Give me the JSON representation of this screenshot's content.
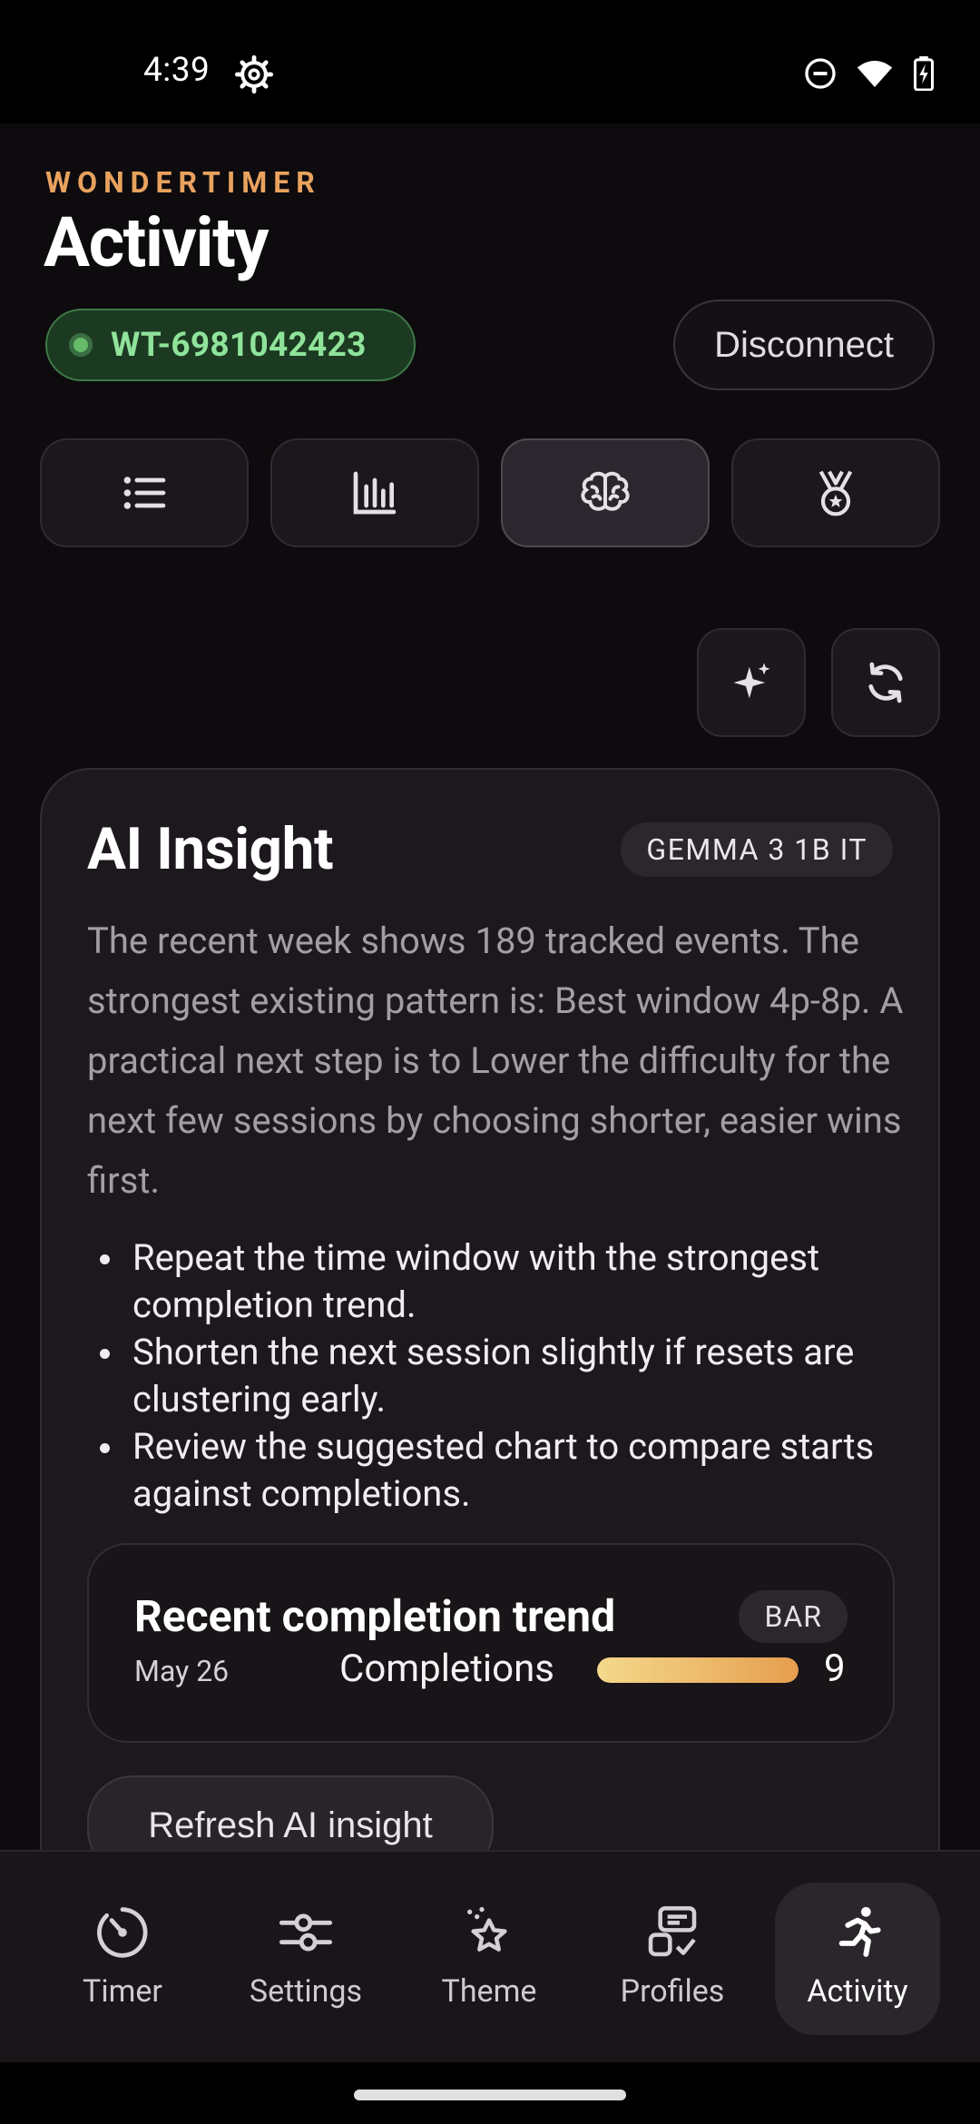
{
  "status_bar": {
    "time": "4:39"
  },
  "header": {
    "brand": "WONDERTIMER",
    "title": "Activity"
  },
  "device": {
    "id": "WT-6981042423",
    "disconnect_label": "Disconnect"
  },
  "tabs": [
    {
      "icon": "list-icon",
      "active": false
    },
    {
      "icon": "bar-chart-icon",
      "active": false
    },
    {
      "icon": "brain-icon",
      "active": true
    },
    {
      "icon": "medal-icon",
      "active": false
    }
  ],
  "actions": [
    {
      "icon": "sparkle-icon"
    },
    {
      "icon": "refresh-icon"
    }
  ],
  "insight": {
    "title": "AI Insight",
    "model": "GEMMA 3 1B IT",
    "summary": "The recent week shows 189 tracked events. The strongest existing pattern is: Best window 4p-8p. A practical next step is to Lower the difficulty for the next few sessions by choosing shorter, easier wins first.",
    "bullets": [
      "Repeat the time window with the strongest completion trend.",
      "Shorten the next session slightly if resets are clustering early.",
      "Review the suggested chart to compare starts against completions."
    ],
    "refresh_label": "Refresh AI insight"
  },
  "trend_card": {
    "title": "Recent completion trend",
    "badge": "BAR",
    "date": "May 26",
    "series_label": "Completions",
    "value_label": "9",
    "value": 9,
    "max": 9
  },
  "nav": [
    {
      "label": "Timer",
      "icon": "timer-icon",
      "active": false
    },
    {
      "label": "Settings",
      "icon": "sliders-icon",
      "active": false
    },
    {
      "label": "Theme",
      "icon": "theme-icon",
      "active": false
    },
    {
      "label": "Profiles",
      "icon": "profiles-icon",
      "active": false
    },
    {
      "label": "Activity",
      "icon": "running-icon",
      "active": true
    }
  ],
  "colors": {
    "accent": "#e9a25e",
    "connected": "#8fe39a",
    "bar_start": "#f5d98c",
    "bar_end": "#e59e4e"
  }
}
